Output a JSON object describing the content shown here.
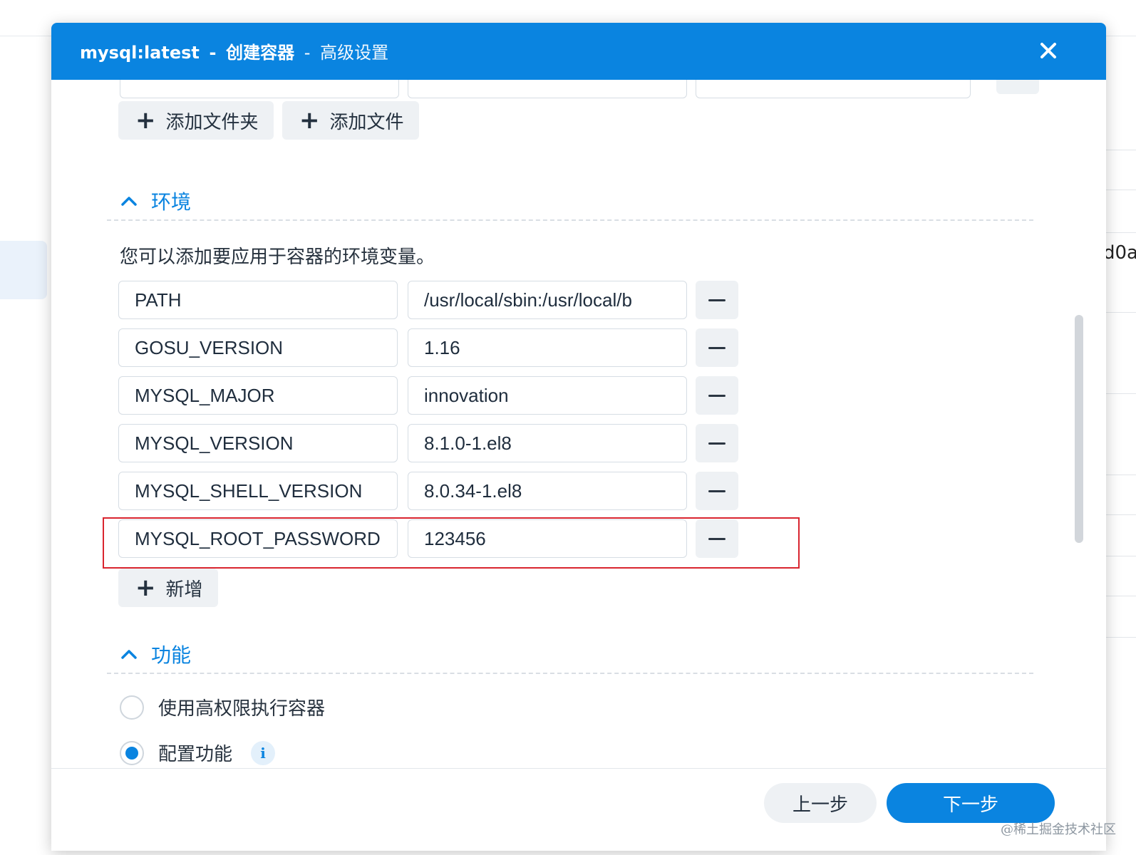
{
  "dialog": {
    "title_main": "mysql:latest",
    "title_sep": "-",
    "title_wizard": "创建容器",
    "title_sep2": "-",
    "title_step": "高级设置",
    "close_icon": "close-icon"
  },
  "volume": {
    "add_folder_label": "添加文件夹",
    "add_file_label": "添加文件"
  },
  "environment": {
    "heading": "环境",
    "description": "您可以添加要应用于容器的环境变量。",
    "vars": [
      {
        "key": "PATH",
        "value": "/usr/local/sbin:/usr/local/b"
      },
      {
        "key": "GOSU_VERSION",
        "value": "1.16"
      },
      {
        "key": "MYSQL_MAJOR",
        "value": "innovation"
      },
      {
        "key": "MYSQL_VERSION",
        "value": "8.1.0-1.el8"
      },
      {
        "key": "MYSQL_SHELL_VERSION",
        "value": "8.0.34-1.el8"
      },
      {
        "key": "MYSQL_ROOT_PASSWORD",
        "value": "123456"
      }
    ],
    "add_label": "新增"
  },
  "capabilities": {
    "heading": "功能",
    "option_privileged": "使用高权限执行容器",
    "option_configure": "配置功能",
    "selected": "配置功能"
  },
  "footer": {
    "prev_label": "上一步",
    "next_label": "下一步"
  },
  "background": {
    "partial_text": "d0a"
  },
  "watermark": "@稀土掘金技术社区",
  "colors": {
    "accent": "#0a84e0",
    "highlight": "#d9252f"
  }
}
